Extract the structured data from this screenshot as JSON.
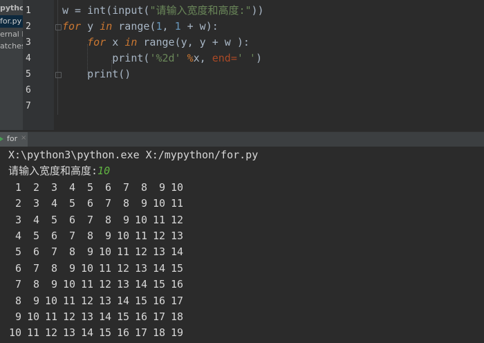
{
  "sidebar": {
    "items": [
      {
        "label": "pytho"
      },
      {
        "label": "for.py"
      },
      {
        "label": "ernal L"
      },
      {
        "label": "atches"
      }
    ]
  },
  "editor": {
    "line_numbers": [
      "1",
      "2",
      "3",
      "4",
      "5",
      "6",
      "7"
    ],
    "lines": [
      [
        {
          "t": "w",
          "c": "plain"
        },
        {
          "t": " = ",
          "c": "op"
        },
        {
          "t": "int",
          "c": "plain"
        },
        {
          "t": "(",
          "c": "plain"
        },
        {
          "t": "input",
          "c": "plain"
        },
        {
          "t": "(",
          "c": "plain"
        },
        {
          "t": "\"请输入宽度和高度:\"",
          "c": "str"
        },
        {
          "t": "))",
          "c": "plain"
        }
      ],
      [
        {
          "t": "for",
          "c": "kw"
        },
        {
          "t": " y ",
          "c": "plain"
        },
        {
          "t": "in",
          "c": "kw"
        },
        {
          "t": " range(",
          "c": "plain"
        },
        {
          "t": "1",
          "c": "num"
        },
        {
          "t": ", ",
          "c": "plain"
        },
        {
          "t": "1",
          "c": "num"
        },
        {
          "t": " + w):",
          "c": "plain"
        }
      ],
      [
        {
          "t": "    ",
          "c": "plain"
        },
        {
          "t": "for",
          "c": "kw"
        },
        {
          "t": " x ",
          "c": "plain"
        },
        {
          "t": "in",
          "c": "kw"
        },
        {
          "t": " range(y, y + w ):",
          "c": "plain"
        }
      ],
      [
        {
          "t": "        print(",
          "c": "plain"
        },
        {
          "t": "'%2d'",
          "c": "str"
        },
        {
          "t": " ",
          "c": "plain"
        },
        {
          "t": "%",
          "c": "pct"
        },
        {
          "t": "x, ",
          "c": "plain"
        },
        {
          "t": "end=",
          "c": "param"
        },
        {
          "t": "' '",
          "c": "str"
        },
        {
          "t": ")",
          "c": "plain"
        }
      ],
      [
        {
          "t": "    print()",
          "c": "plain"
        }
      ],
      [],
      []
    ]
  },
  "run_panel": {
    "tab_label": "for",
    "close_glyph": "×"
  },
  "console": {
    "command": "X:\\python3\\python.exe X:/mypython/for.py",
    "prompt": "请输入宽度和高度:",
    "input_value": "10",
    "table": [
      [
        "1",
        "2",
        "3",
        "4",
        "5",
        "6",
        "7",
        "8",
        "9",
        "10"
      ],
      [
        "2",
        "3",
        "4",
        "5",
        "6",
        "7",
        "8",
        "9",
        "10",
        "11"
      ],
      [
        "3",
        "4",
        "5",
        "6",
        "7",
        "8",
        "9",
        "10",
        "11",
        "12"
      ],
      [
        "4",
        "5",
        "6",
        "7",
        "8",
        "9",
        "10",
        "11",
        "12",
        "13"
      ],
      [
        "5",
        "6",
        "7",
        "8",
        "9",
        "10",
        "11",
        "12",
        "13",
        "14"
      ],
      [
        "6",
        "7",
        "8",
        "9",
        "10",
        "11",
        "12",
        "13",
        "14",
        "15"
      ],
      [
        "7",
        "8",
        "9",
        "10",
        "11",
        "12",
        "13",
        "14",
        "15",
        "16"
      ],
      [
        "8",
        "9",
        "10",
        "11",
        "12",
        "13",
        "14",
        "15",
        "16",
        "17"
      ],
      [
        "9",
        "10",
        "11",
        "12",
        "13",
        "14",
        "15",
        "16",
        "17",
        "18"
      ],
      [
        "10",
        "11",
        "12",
        "13",
        "14",
        "15",
        "16",
        "17",
        "18",
        "19"
      ]
    ]
  }
}
